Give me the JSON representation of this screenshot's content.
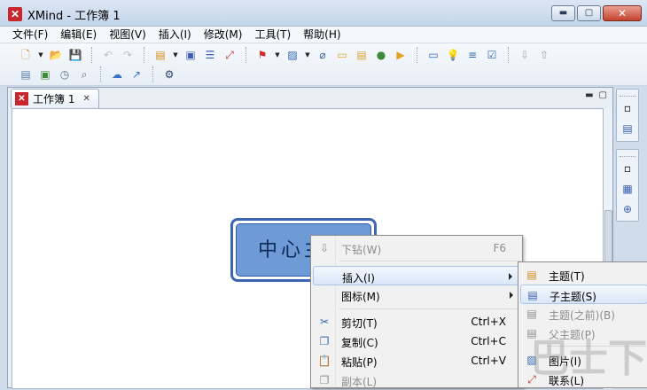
{
  "window": {
    "title": "XMind - 工作簿 1",
    "app_icon": "xmind-logo-icon",
    "controls": {
      "minimize": "▬",
      "maximize": "▢",
      "close": "✕"
    }
  },
  "menubar": {
    "items": [
      "文件(F)",
      "编辑(E)",
      "视图(V)",
      "插入(I)",
      "修改(M)",
      "工具(T)",
      "帮助(H)"
    ]
  },
  "toolbar": {
    "row1": [
      {
        "name": "new-icon",
        "glyph": "🗋",
        "color": "#c08a2a"
      },
      {
        "name": "dropdown-arrow",
        "glyph": "▼"
      },
      {
        "name": "open-folder-icon",
        "glyph": "📂",
        "color": "#d9a43a"
      },
      {
        "name": "save-icon",
        "glyph": "💾",
        "color": "#9aa6b4"
      },
      {
        "name": "sep"
      },
      {
        "name": "undo-icon",
        "glyph": "↶",
        "color": "#b9c3cf"
      },
      {
        "name": "redo-icon",
        "glyph": "↷",
        "color": "#b9c3cf"
      },
      {
        "name": "sep"
      },
      {
        "name": "insert-topic-icon",
        "glyph": "▤",
        "color": "#d18a1a"
      },
      {
        "name": "dropdown-arrow",
        "glyph": "▼"
      },
      {
        "name": "boundary-icon",
        "glyph": "▣",
        "color": "#3a5fb0"
      },
      {
        "name": "summary-icon",
        "glyph": "☰",
        "color": "#3a5fb0"
      },
      {
        "name": "relationship-icon",
        "glyph": "⤢",
        "color": "#c0392b"
      },
      {
        "name": "sep"
      },
      {
        "name": "marker-flag-icon",
        "glyph": "⚑",
        "color": "#d8262c"
      },
      {
        "name": "dropdown-arrow",
        "glyph": "▼"
      },
      {
        "name": "image-icon",
        "glyph": "▨",
        "color": "#2f66b3"
      },
      {
        "name": "dropdown-arrow",
        "glyph": "▼"
      },
      {
        "name": "attachment-icon",
        "glyph": "⌀",
        "color": "#3b5f9a"
      },
      {
        "name": "label-icon",
        "glyph": "▭",
        "color": "#d9a12a"
      },
      {
        "name": "notes-icon",
        "glyph": "▤",
        "color": "#d9a12a"
      },
      {
        "name": "hyperlink-globe-icon",
        "glyph": "●",
        "color": "#3d8a3a"
      },
      {
        "name": "audio-note-icon",
        "glyph": "▶",
        "color": "#e0a020"
      },
      {
        "name": "sep"
      },
      {
        "name": "presentation-icon",
        "glyph": "▭",
        "color": "#2f66b3"
      },
      {
        "name": "brainstorm-bulb-icon",
        "glyph": "💡",
        "color": "#e8c020"
      },
      {
        "name": "gantt-icon",
        "glyph": "≡",
        "color": "#2f66b3"
      },
      {
        "name": "task-info-icon",
        "glyph": "☑",
        "color": "#2f66b3"
      },
      {
        "name": "sep"
      },
      {
        "name": "drill-down-icon",
        "glyph": "⇩",
        "color": "#9aa6b4"
      },
      {
        "name": "drill-up-icon",
        "glyph": "⇧",
        "color": "#9aa6b4"
      }
    ],
    "row2": [
      {
        "name": "outline-icon",
        "glyph": "▤",
        "color": "#5c7ea8"
      },
      {
        "name": "overview-icon",
        "glyph": "▣",
        "color": "#3d8a3a"
      },
      {
        "name": "clock-icon",
        "glyph": "◷",
        "color": "#5c6f88"
      },
      {
        "name": "search-doc-icon",
        "glyph": "⌕",
        "color": "#5c6f88"
      },
      {
        "name": "sep"
      },
      {
        "name": "cloud-upload-icon",
        "glyph": "☁",
        "color": "#3a72c4"
      },
      {
        "name": "share-export-icon",
        "glyph": "↗",
        "color": "#3a72c4"
      },
      {
        "name": "sep"
      },
      {
        "name": "settings-gear-icon",
        "glyph": "⚙",
        "color": "#2e4466"
      }
    ]
  },
  "editor": {
    "tab_label": "工作簿 1",
    "tab_close": "✕",
    "view_controls": [
      "▬",
      "▢"
    ],
    "central_topic": "中心主题"
  },
  "side_panel": {
    "top_icons": [
      "restore-icon",
      "outline-view-icon"
    ],
    "bottom_icons": [
      "restore-icon",
      "properties-icon",
      "zoom-icon"
    ]
  },
  "context_menu": {
    "items": [
      {
        "label": "下钻(W)",
        "shortcut": "F6",
        "disabled": true,
        "icon": "drill-down-icon",
        "glyph": "⇩"
      },
      {
        "label": "插入(I)",
        "submenu": true,
        "hover": true
      },
      {
        "label": "图标(M)",
        "submenu": true
      },
      {
        "separator": true
      },
      {
        "label": "剪切(T)",
        "shortcut": "Ctrl+X",
        "icon": "cut-scissors-icon",
        "glyph": "✂"
      },
      {
        "label": "复制(C)",
        "shortcut": "Ctrl+C",
        "icon": "copy-icon",
        "glyph": "❐"
      },
      {
        "label": "粘贴(P)",
        "shortcut": "Ctrl+V",
        "icon": "paste-icon",
        "glyph": "📋"
      },
      {
        "label": "副本(L)",
        "disabled": true,
        "icon": "duplicate-icon",
        "glyph": "❐"
      }
    ]
  },
  "submenu_insert": {
    "items": [
      {
        "label": "主题(T)",
        "icon": "topic-icon",
        "glyph": "▤"
      },
      {
        "label": "子主题(S)",
        "hover": true,
        "icon": "subtopic-icon",
        "glyph": "▤"
      },
      {
        "label": "主题(之前)(B)",
        "disabled": true,
        "icon": "topic-before-icon",
        "glyph": "▤"
      },
      {
        "label": "父主题(P)",
        "disabled": true,
        "icon": "parent-topic-icon",
        "glyph": "▤"
      },
      {
        "separator": true
      },
      {
        "label": "图片(I)",
        "icon": "image-icon",
        "glyph": "▨"
      },
      {
        "label": "联系(L)",
        "icon": "relationship-icon",
        "glyph": "⤢"
      }
    ]
  },
  "watermark": "巴士下载",
  "colors": {
    "accent": "#3d66b0",
    "topic_fill": "#6e9ad6",
    "brand_red": "#c8262c"
  }
}
